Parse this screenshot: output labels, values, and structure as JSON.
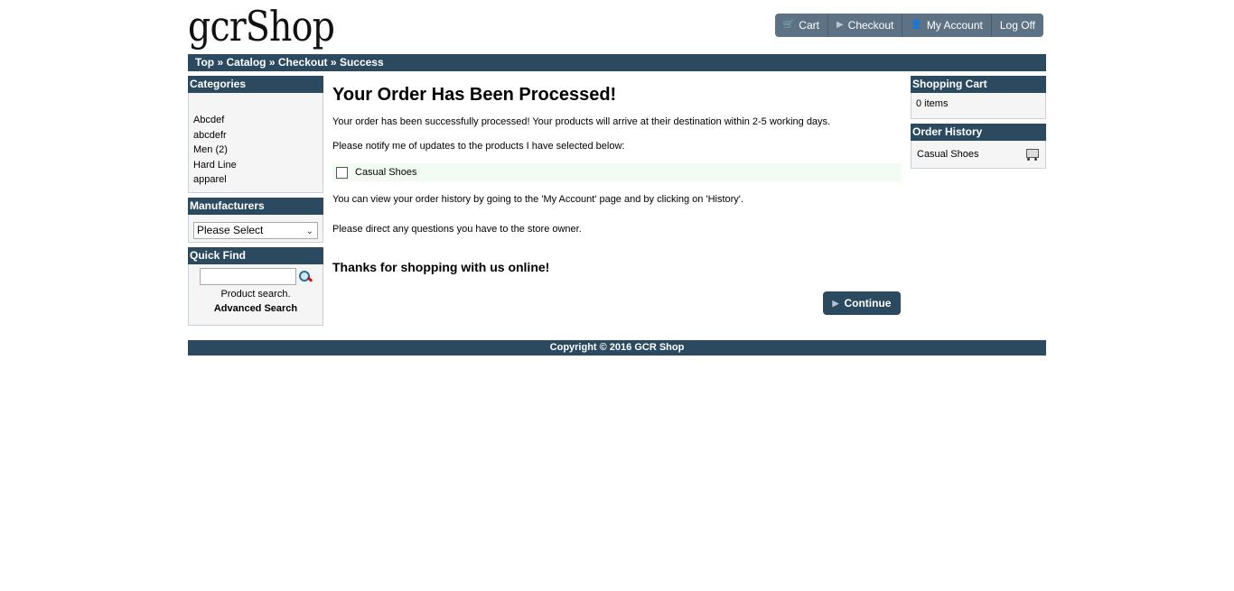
{
  "logo": {
    "text": "gcrShop"
  },
  "topnav": {
    "cart": "Cart",
    "checkout": "Checkout",
    "account": "My Account",
    "logoff": "Log Off"
  },
  "breadcrumb": {
    "top": "Top",
    "sep": "»",
    "catalog": "Catalog",
    "checkout": "Checkout",
    "success": "Success"
  },
  "categories": {
    "title": "Categories",
    "items": [
      "Abcdef",
      "abcdefr",
      "Men (2)",
      "Hard Line",
      "apparel"
    ]
  },
  "manufacturers": {
    "title": "Manufacturers",
    "selected": "Please Select"
  },
  "quickfind": {
    "title": "Quick Find",
    "hint": "Product search.",
    "advanced": "Advanced Search"
  },
  "main": {
    "heading": "Your Order Has Been Processed!",
    "line1": "Your order has been successfully processed! Your products will arrive at their destination within 2-5 working days.",
    "line2": "Please notify me of updates to the products I have selected below:",
    "product": "Casual Shoes",
    "line3": "You can view your order history by going to the 'My Account' page and by clicking on 'History'.",
    "line4": "Please direct any questions you have to the store owner.",
    "thanks": "Thanks for shopping with us online!",
    "continue": "Continue"
  },
  "shopping_cart": {
    "title": "Shopping Cart",
    "items": "0 items"
  },
  "order_history": {
    "title": "Order History",
    "item": "Casual Shoes"
  },
  "footer": {
    "text": "Copyright © 2016 GCR Shop"
  },
  "colors": {
    "header": "#2c4a5f",
    "button": "#5e7285",
    "notify_bg": "#f2fcf2"
  }
}
